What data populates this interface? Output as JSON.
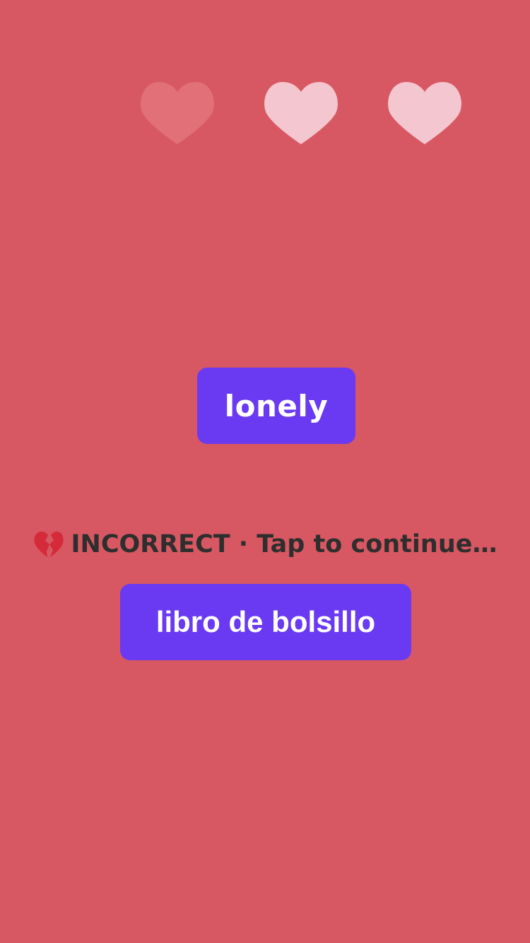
{
  "lives": {
    "total": 3,
    "remaining": 2,
    "icons": [
      {
        "icon": "heart-icon",
        "state": "lost",
        "color": "#e17078"
      },
      {
        "icon": "heart-icon",
        "state": "active",
        "color": "#f4c6d0"
      },
      {
        "icon": "heart-icon",
        "state": "active",
        "color": "#f4c6d0"
      }
    ]
  },
  "prompt": {
    "word": "lonely"
  },
  "feedback": {
    "icon": "broken-heart-icon",
    "text": "INCORRECT · Tap to continue…"
  },
  "answer": {
    "label": "libro de bolsillo"
  },
  "colors": {
    "background": "#d75862",
    "button": "#6a3af2",
    "button_text": "#ffffff",
    "feedback_text": "#2e2e2e"
  }
}
